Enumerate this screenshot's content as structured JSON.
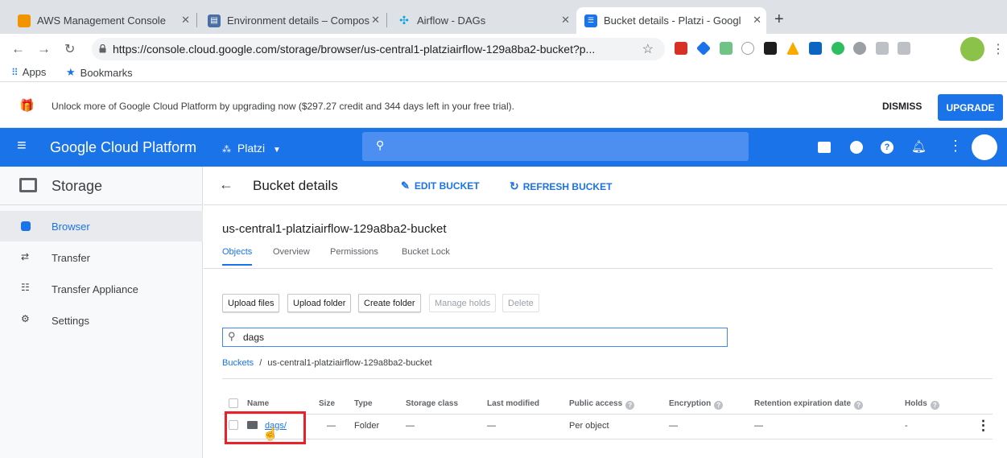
{
  "browser": {
    "tabs": [
      {
        "title": "AWS Management Console",
        "active": false
      },
      {
        "title": "Environment details – Compos",
        "active": false
      },
      {
        "title": "Airflow - DAGs",
        "active": false
      },
      {
        "title": "Bucket details - Platzi - Googl",
        "active": true
      }
    ],
    "url": "https://console.cloud.google.com/storage/browser/us-central1-platziairflow-129a8ba2-bucket?p...",
    "bookmarks": [
      {
        "label": "Apps"
      },
      {
        "label": "Bookmarks"
      }
    ]
  },
  "promo": {
    "text": "Unlock more of Google Cloud Platform by upgrading now ($297.27 credit and 344 days left in your free trial).",
    "dismiss": "DISMISS",
    "upgrade": "UPGRADE"
  },
  "gcp": {
    "brand": "Google Cloud Platform",
    "project": "Platzi"
  },
  "sidebar": {
    "title": "Storage",
    "items": [
      {
        "label": "Browser",
        "selected": true
      },
      {
        "label": "Transfer",
        "selected": false
      },
      {
        "label": "Transfer Appliance",
        "selected": false
      },
      {
        "label": "Settings",
        "selected": false
      }
    ]
  },
  "main": {
    "title": "Bucket details",
    "edit_bucket": "EDIT BUCKET",
    "refresh_bucket": "REFRESH BUCKET",
    "bucket_name": "us-central1-platziairflow-129a8ba2-bucket",
    "tabs": [
      "Objects",
      "Overview",
      "Permissions",
      "Bucket Lock"
    ],
    "buttons": {
      "upload_files": "Upload files",
      "upload_folder": "Upload folder",
      "create_folder": "Create folder",
      "manage_holds": "Manage holds",
      "delete": "Delete"
    },
    "filter_value": "dags",
    "breadcrumb": {
      "root": "Buckets",
      "separator": "/",
      "current": "us-central1-platziairflow-129a8ba2-bucket"
    },
    "table": {
      "headers": [
        "Name",
        "Size",
        "Type",
        "Storage class",
        "Last modified",
        "Public access",
        "Encryption",
        "Retention expiration date",
        "Holds"
      ],
      "rows": [
        {
          "name": "dags/",
          "size": "—",
          "type": "Folder",
          "storage_class": "—",
          "last_modified": "—",
          "public_access": "Per object",
          "encryption": "—",
          "retention": "—",
          "holds": "-"
        }
      ]
    }
  },
  "colors": {
    "gcp_blue": "#1a73e8",
    "highlight_red": "#e8222a"
  }
}
